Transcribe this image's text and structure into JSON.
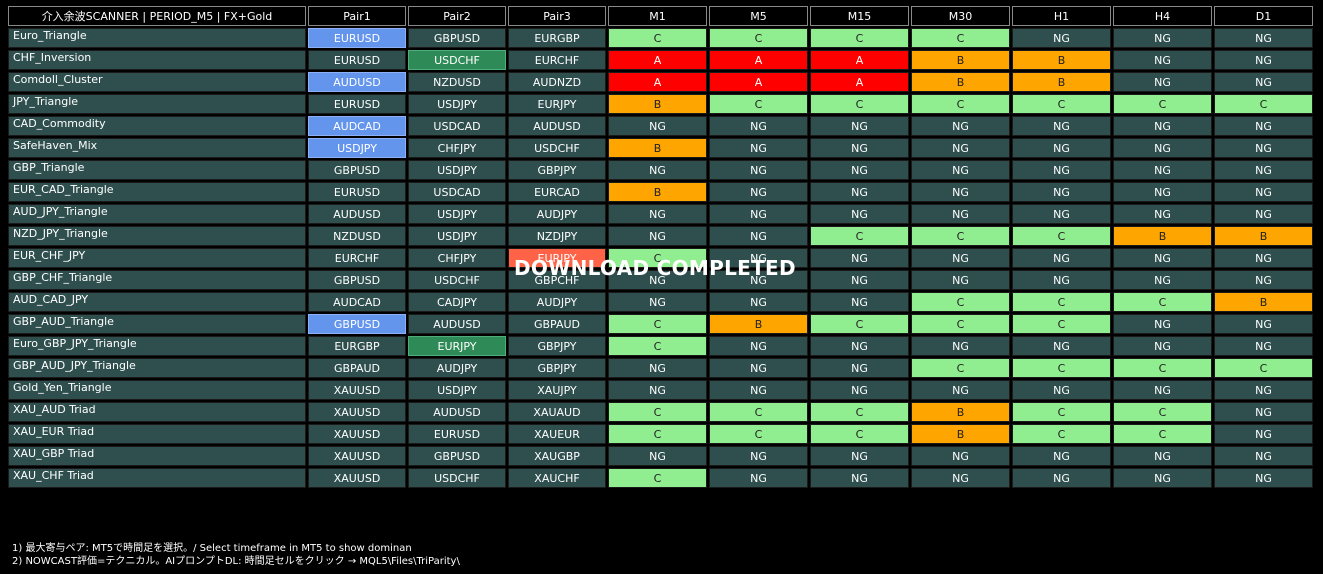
{
  "header": {
    "title": "介入余波SCANNER | PERIOD_M5 | FX+Gold",
    "pair_headers": [
      "Pair1",
      "Pair2",
      "Pair3"
    ],
    "timeframes": [
      "M1",
      "M5",
      "M15",
      "M30",
      "H1",
      "H4",
      "D1"
    ]
  },
  "rows": [
    {
      "name": "Euro_Triangle",
      "pairs": [
        "EURUSD",
        "GBPUSD",
        "EURGBP"
      ],
      "pair_hl": [
        "blue",
        "",
        ""
      ],
      "grades": [
        "C",
        "C",
        "C",
        "C",
        "NG",
        "NG",
        "NG"
      ]
    },
    {
      "name": "CHF_Inversion",
      "pairs": [
        "EURUSD",
        "USDCHF",
        "EURCHF"
      ],
      "pair_hl": [
        "",
        "green",
        ""
      ],
      "grades": [
        "A",
        "A",
        "A",
        "B",
        "B",
        "NG",
        "NG"
      ]
    },
    {
      "name": "Comdoll_Cluster",
      "pairs": [
        "AUDUSD",
        "NZDUSD",
        "AUDNZD"
      ],
      "pair_hl": [
        "blue",
        "",
        ""
      ],
      "grades": [
        "A",
        "A",
        "A",
        "B",
        "B",
        "NG",
        "NG"
      ]
    },
    {
      "name": "JPY_Triangle",
      "pairs": [
        "EURUSD",
        "USDJPY",
        "EURJPY"
      ],
      "pair_hl": [
        "",
        "",
        ""
      ],
      "grades": [
        "B",
        "C",
        "C",
        "C",
        "C",
        "C",
        "C"
      ]
    },
    {
      "name": "CAD_Commodity",
      "pairs": [
        "AUDCAD",
        "USDCAD",
        "AUDUSD"
      ],
      "pair_hl": [
        "blue",
        "",
        ""
      ],
      "grades": [
        "NG",
        "NG",
        "NG",
        "NG",
        "NG",
        "NG",
        "NG"
      ]
    },
    {
      "name": "SafeHaven_Mix",
      "pairs": [
        "USDJPY",
        "CHFJPY",
        "USDCHF"
      ],
      "pair_hl": [
        "blue",
        "",
        ""
      ],
      "grades": [
        "B",
        "NG",
        "NG",
        "NG",
        "NG",
        "NG",
        "NG"
      ]
    },
    {
      "name": "GBP_Triangle",
      "pairs": [
        "GBPUSD",
        "USDJPY",
        "GBPJPY"
      ],
      "pair_hl": [
        "",
        "",
        ""
      ],
      "grades": [
        "NG",
        "NG",
        "NG",
        "NG",
        "NG",
        "NG",
        "NG"
      ]
    },
    {
      "name": "EUR_CAD_Triangle",
      "pairs": [
        "EURUSD",
        "USDCAD",
        "EURCAD"
      ],
      "pair_hl": [
        "",
        "",
        ""
      ],
      "grades": [
        "B",
        "NG",
        "NG",
        "NG",
        "NG",
        "NG",
        "NG"
      ]
    },
    {
      "name": "AUD_JPY_Triangle",
      "pairs": [
        "AUDUSD",
        "USDJPY",
        "AUDJPY"
      ],
      "pair_hl": [
        "",
        "",
        ""
      ],
      "grades": [
        "NG",
        "NG",
        "NG",
        "NG",
        "NG",
        "NG",
        "NG"
      ]
    },
    {
      "name": "NZD_JPY_Triangle",
      "pairs": [
        "NZDUSD",
        "USDJPY",
        "NZDJPY"
      ],
      "pair_hl": [
        "",
        "",
        ""
      ],
      "grades": [
        "NG",
        "NG",
        "C",
        "C",
        "C",
        "B",
        "B"
      ]
    },
    {
      "name": "EUR_CHF_JPY",
      "pairs": [
        "EURCHF",
        "CHFJPY",
        "EURJPY"
      ],
      "pair_hl": [
        "",
        "",
        "red"
      ],
      "grades": [
        "C",
        "NG",
        "NG",
        "NG",
        "NG",
        "NG",
        "NG"
      ]
    },
    {
      "name": "GBP_CHF_Triangle",
      "pairs": [
        "GBPUSD",
        "USDCHF",
        "GBPCHF"
      ],
      "pair_hl": [
        "",
        "",
        ""
      ],
      "grades": [
        "NG",
        "NG",
        "NG",
        "NG",
        "NG",
        "NG",
        "NG"
      ]
    },
    {
      "name": "AUD_CAD_JPY",
      "pairs": [
        "AUDCAD",
        "CADJPY",
        "AUDJPY"
      ],
      "pair_hl": [
        "",
        "",
        ""
      ],
      "grades": [
        "NG",
        "NG",
        "NG",
        "C",
        "C",
        "C",
        "B"
      ]
    },
    {
      "name": "GBP_AUD_Triangle",
      "pairs": [
        "GBPUSD",
        "AUDUSD",
        "GBPAUD"
      ],
      "pair_hl": [
        "blue",
        "",
        ""
      ],
      "grades": [
        "C",
        "B",
        "C",
        "C",
        "C",
        "NG",
        "NG"
      ]
    },
    {
      "name": "Euro_GBP_JPY_Triangle",
      "pairs": [
        "EURGBP",
        "EURJPY",
        "GBPJPY"
      ],
      "pair_hl": [
        "",
        "green",
        ""
      ],
      "grades": [
        "C",
        "NG",
        "NG",
        "NG",
        "NG",
        "NG",
        "NG"
      ]
    },
    {
      "name": "GBP_AUD_JPY_Triangle",
      "pairs": [
        "GBPAUD",
        "AUDJPY",
        "GBPJPY"
      ],
      "pair_hl": [
        "",
        "",
        ""
      ],
      "grades": [
        "NG",
        "NG",
        "NG",
        "C",
        "C",
        "C",
        "C"
      ]
    },
    {
      "name": "Gold_Yen_Triangle",
      "pairs": [
        "XAUUSD",
        "USDJPY",
        "XAUJPY"
      ],
      "pair_hl": [
        "",
        "",
        ""
      ],
      "grades": [
        "NG",
        "NG",
        "NG",
        "NG",
        "NG",
        "NG",
        "NG"
      ]
    },
    {
      "name": "XAU_AUD Triad",
      "pairs": [
        "XAUUSD",
        "AUDUSD",
        "XAUAUD"
      ],
      "pair_hl": [
        "",
        "",
        ""
      ],
      "grades": [
        "C",
        "C",
        "C",
        "B",
        "C",
        "C",
        "NG"
      ]
    },
    {
      "name": "XAU_EUR Triad",
      "pairs": [
        "XAUUSD",
        "EURUSD",
        "XAUEUR"
      ],
      "pair_hl": [
        "",
        "",
        ""
      ],
      "grades": [
        "C",
        "C",
        "C",
        "B",
        "C",
        "C",
        "NG"
      ]
    },
    {
      "name": "XAU_GBP Triad",
      "pairs": [
        "XAUUSD",
        "GBPUSD",
        "XAUGBP"
      ],
      "pair_hl": [
        "",
        "",
        ""
      ],
      "grades": [
        "NG",
        "NG",
        "NG",
        "NG",
        "NG",
        "NG",
        "NG"
      ]
    },
    {
      "name": "XAU_CHF Triad",
      "pairs": [
        "XAUUSD",
        "USDCHF",
        "XAUCHF"
      ],
      "pair_hl": [
        "",
        "",
        ""
      ],
      "grades": [
        "C",
        "NG",
        "NG",
        "NG",
        "NG",
        "NG",
        "NG"
      ]
    }
  ],
  "overlay_text": "DOWNLOAD COMPLETED",
  "notes": [
    "1) 最大寄与ペア: MT5で時間足を選択。/ Select timeframe in MT5 to show dominan",
    "2) NOWCAST評価=テクニカル。AIプロンプトDL: 時間足セルをクリック → MQL5\\Files\\TriParity\\"
  ],
  "colors": {
    "cell_default": "#2f4f4f",
    "grade_C": "#90ee90",
    "grade_B": "#ffa500",
    "grade_A": "#ff0000",
    "pair_selected": "#6495ed",
    "pair_dominant": "#2e8b57",
    "pair_alert": "#ff6347"
  }
}
